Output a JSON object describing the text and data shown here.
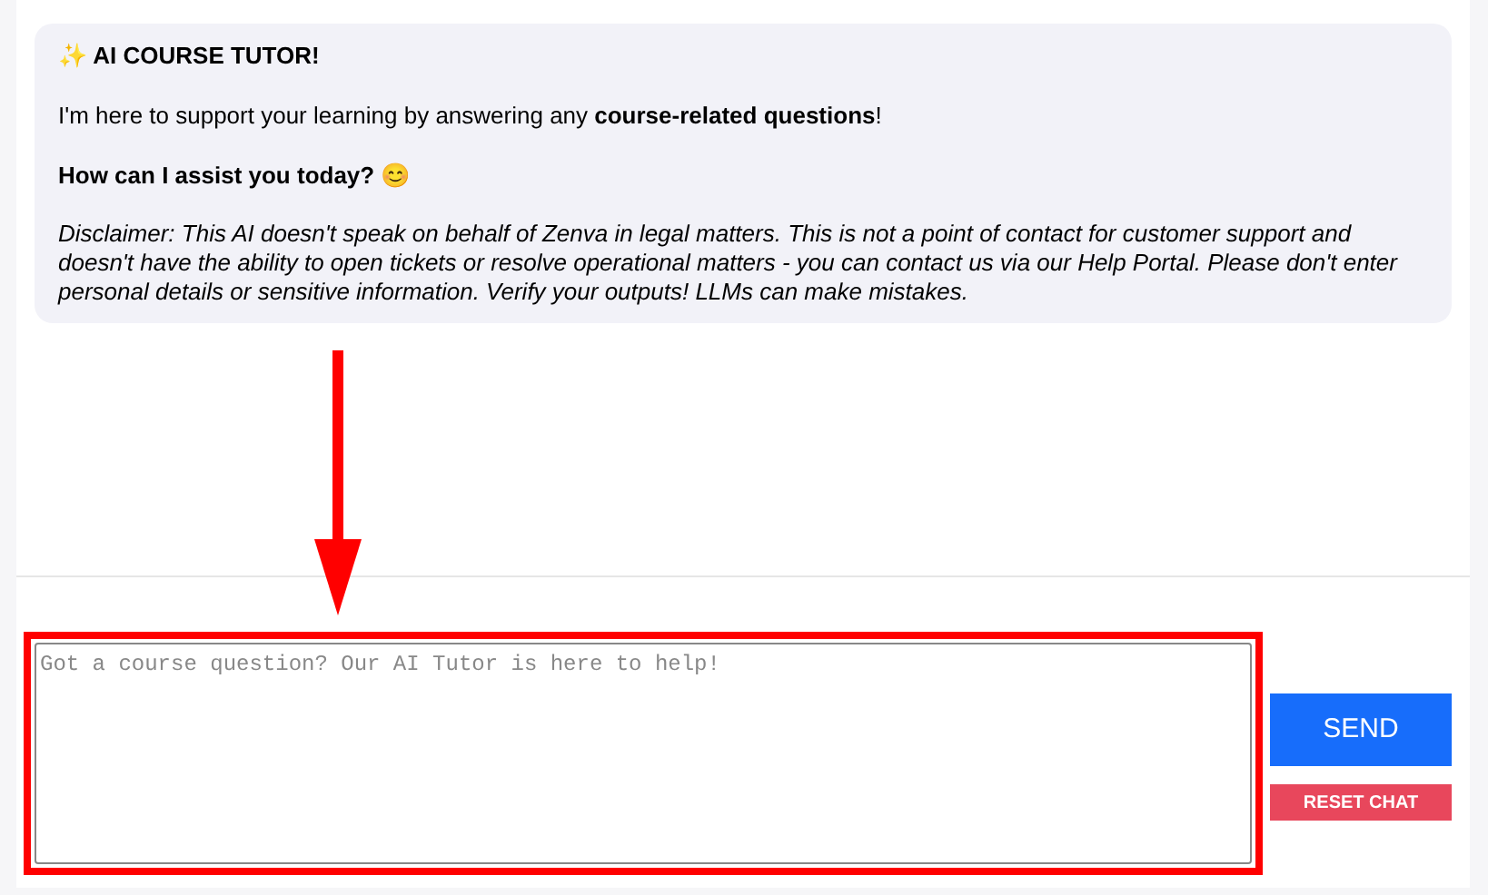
{
  "welcome": {
    "title": "✨ AI COURSE TUTOR!",
    "intro": "I'm here to support your learning by answering any **course-related questions**!",
    "question": "How can I assist you today? 😊",
    "disclaimer": "Disclaimer: This AI doesn't speak on behalf of Zenva in legal matters. This is not a point of contact for customer support and doesn't have the ability to open tickets or resolve operational matters - you can contact us via our Help Portal. Please don't enter personal details or sensitive information. Verify your outputs! LLMs can make mistakes."
  },
  "message_field": {
    "placeholder": "Got a course question? Our AI Tutor is here to help!"
  },
  "buttons": [
    {
      "kind": "send",
      "label": "SEND"
    },
    {
      "kind": "reset",
      "label": "RESET CHAT"
    }
  ]
}
